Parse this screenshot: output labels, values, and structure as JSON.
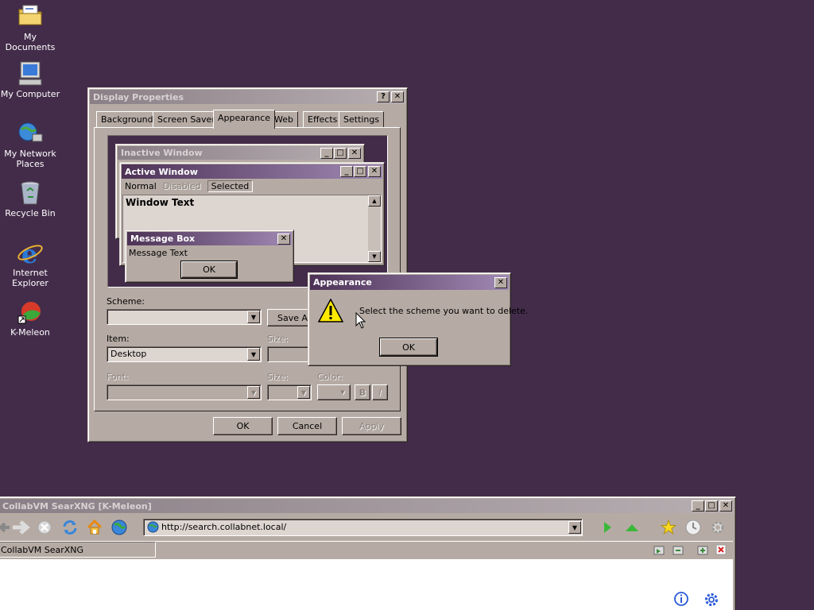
{
  "desktop": {
    "icons": [
      {
        "label": "My Documents"
      },
      {
        "label": "My Computer"
      },
      {
        "label": "My Network Places"
      },
      {
        "label": "Recycle Bin"
      },
      {
        "label": "Internet Explorer"
      },
      {
        "label": "K-Meleon"
      }
    ]
  },
  "display_props": {
    "title": "Display Properties",
    "help_btn": "?",
    "close_btn": "✕",
    "tabs": [
      "Background",
      "Screen Saver",
      "Appearance",
      "Web",
      "Effects",
      "Settings"
    ],
    "active_tab": "Appearance",
    "preview": {
      "inactive_title": "Inactive Window",
      "active_title": "Active Window",
      "menu_normal": "Normal",
      "menu_disabled": "Disabled",
      "menu_selected": "Selected",
      "window_text": "Window Text",
      "msgbox_title": "Message Box",
      "msgbox_text": "Message Text",
      "msgbox_ok": "OK"
    },
    "scheme_label": "Scheme:",
    "scheme_value": "",
    "save_as": "Save As...",
    "item_label": "Item:",
    "item_value": "Desktop",
    "size_label": "Size:",
    "font_label": "Font:",
    "font_size_label": "Size:",
    "color_label": "Color:",
    "bold_btn": "B",
    "italic_btn": "I",
    "ok": "OK",
    "cancel": "Cancel",
    "apply": "Apply"
  },
  "appearance_dialog": {
    "title": "Appearance",
    "message": "Select the scheme you want to delete.",
    "ok": "OK",
    "icon": "warning-icon"
  },
  "browser": {
    "title": "CollabVM SearXNG [K-Meleon]",
    "url": "http://search.collabnet.local/",
    "tab_label": "CollabVM SearXNG",
    "icons": [
      "back-icon",
      "forward-icon",
      "stop-icon",
      "reload-icon",
      "home-icon",
      "globe-icon"
    ]
  },
  "colors": {
    "desktop_bg": "#432c4a",
    "active_title_start": "#4d3256",
    "active_title_end": "#a089b4",
    "window_face": "#b6aba4"
  }
}
